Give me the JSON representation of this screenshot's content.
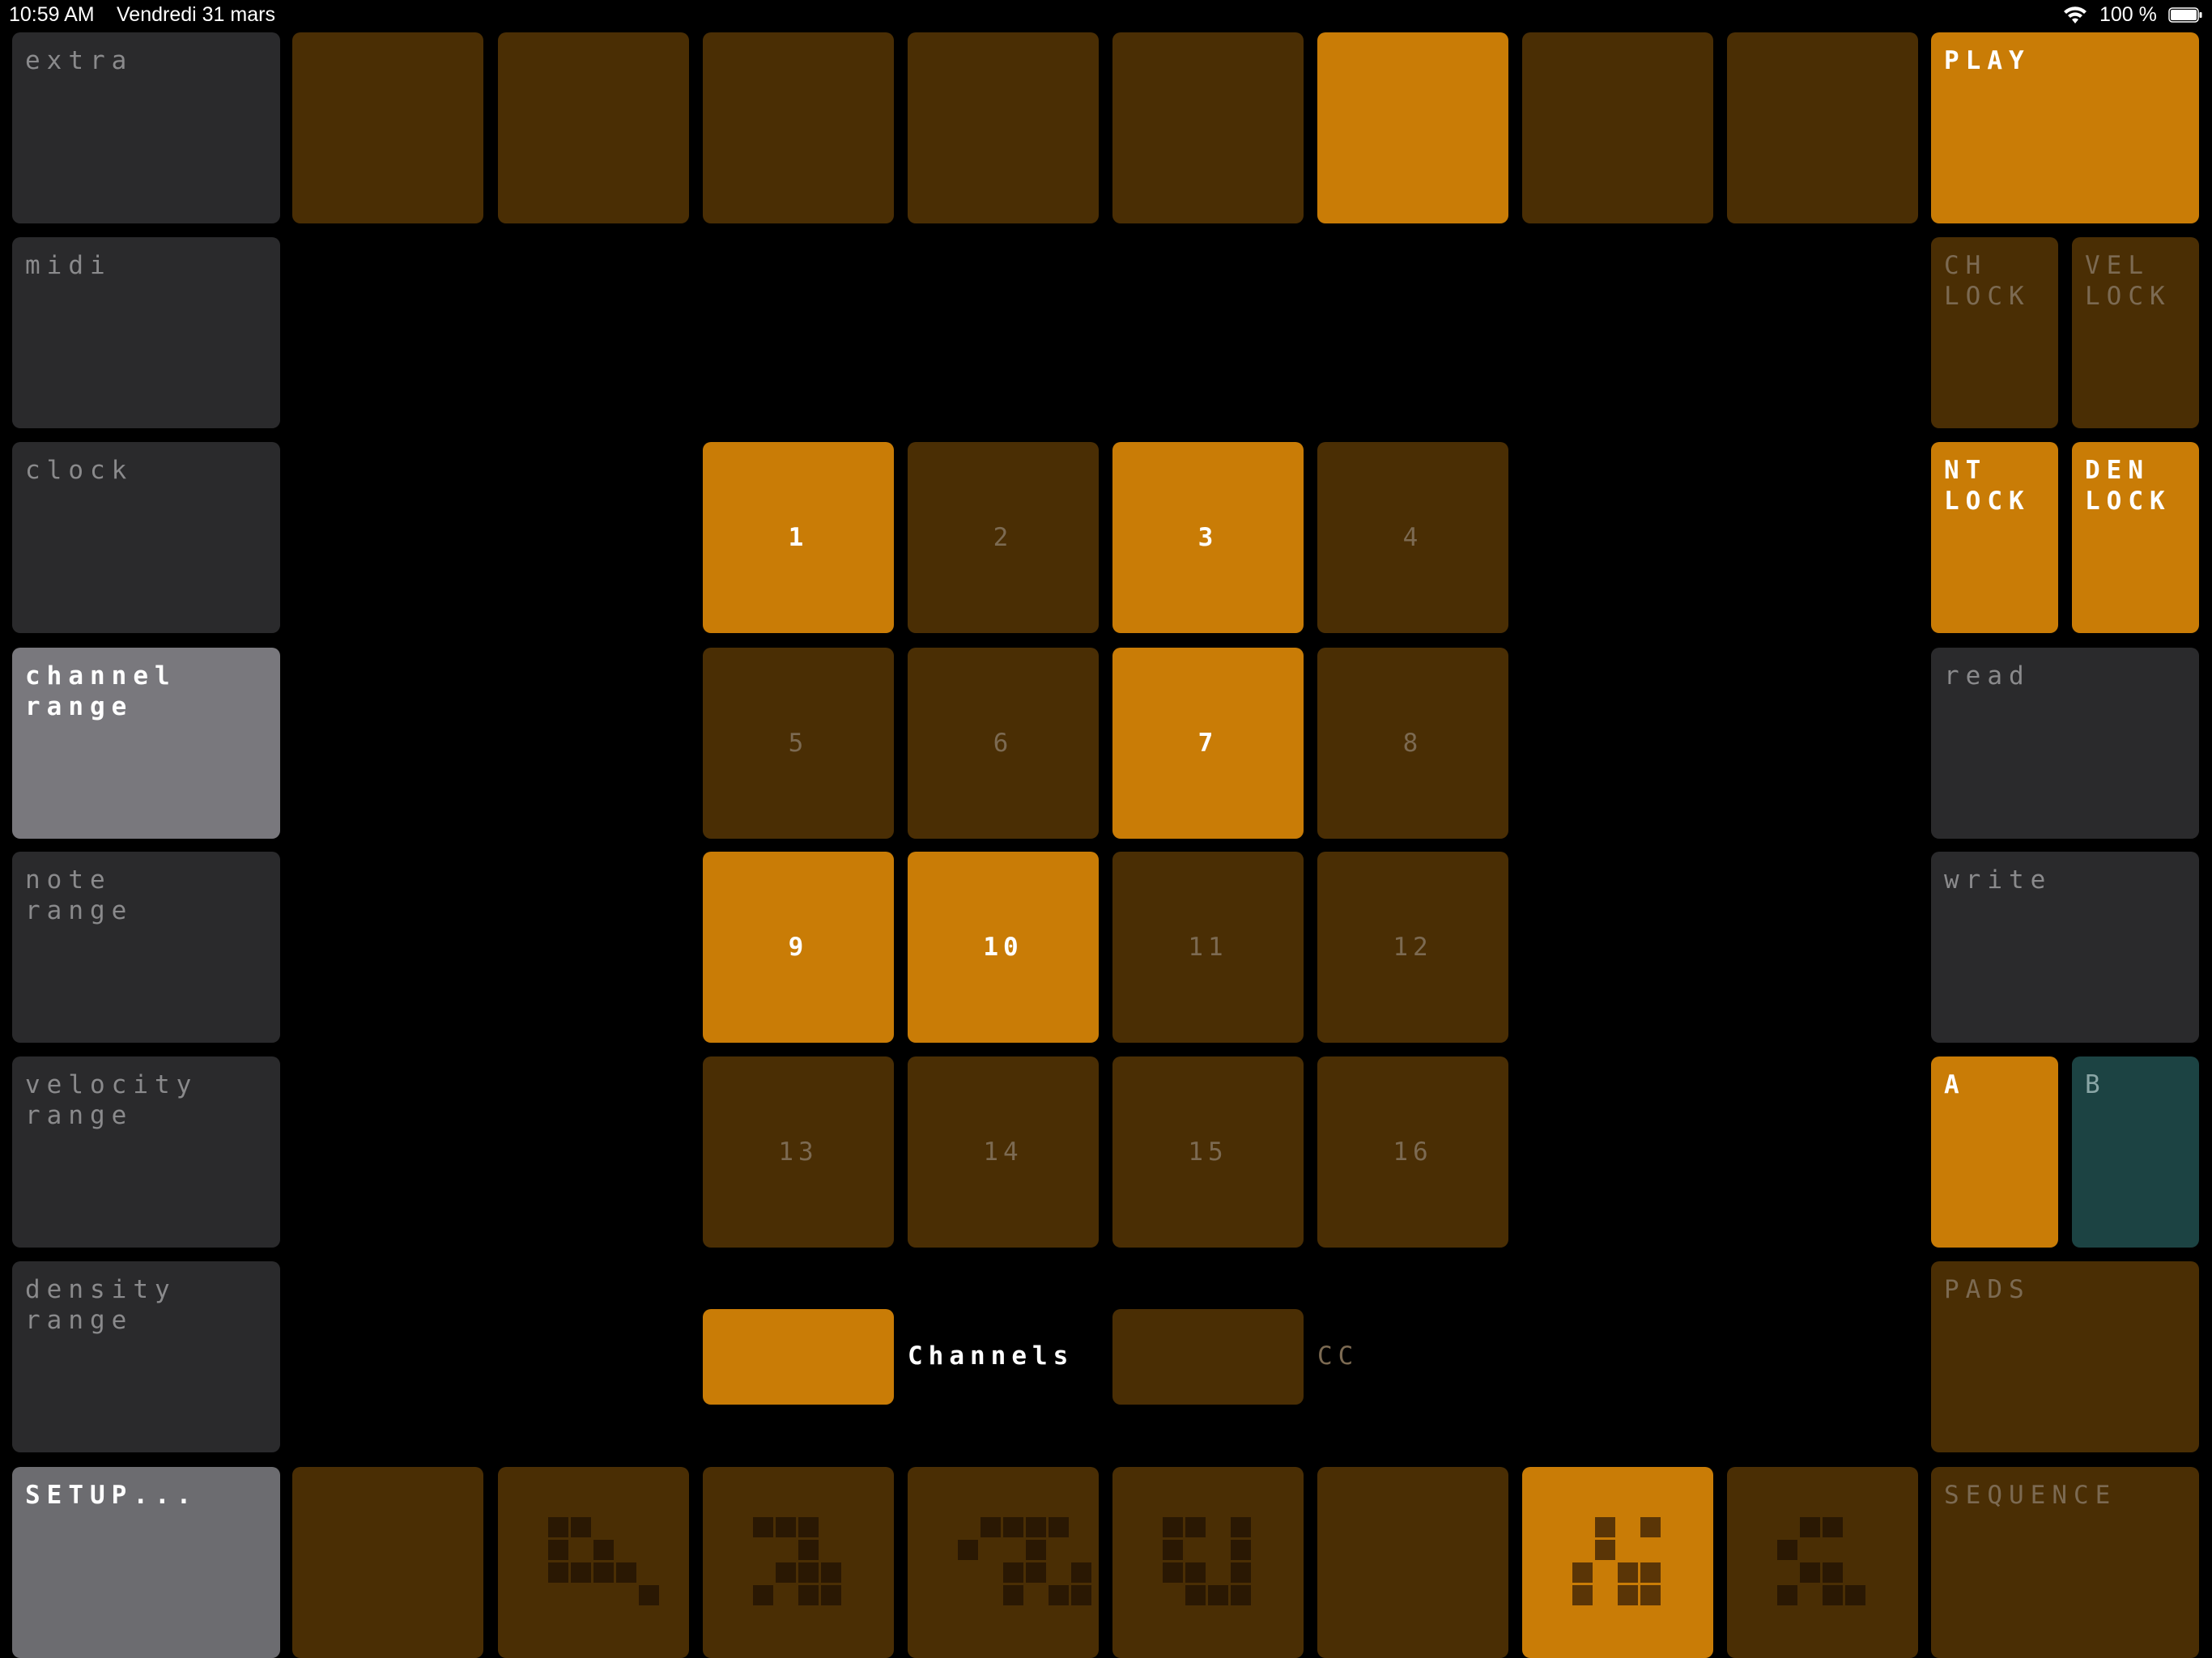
{
  "status_bar": {
    "time": "10:59 AM",
    "date": "Vendredi 31 mars",
    "battery": "100 %"
  },
  "colors": {
    "pad_off": "#4a2e04",
    "pad_on": "#c97c06",
    "gray": "#2a2a2c",
    "gray_on": "#79787d",
    "teal": "#1c4343"
  },
  "left_menu": [
    {
      "label": "extra",
      "active": false
    },
    {
      "label": "midi",
      "active": false
    },
    {
      "label": "clock",
      "active": false
    },
    {
      "label": "channel\nrange",
      "active": true
    },
    {
      "label": "note\nrange",
      "active": false
    },
    {
      "label": "velocity\nrange",
      "active": false
    },
    {
      "label": "density\nrange",
      "active": false
    }
  ],
  "setup_button": "SETUP...",
  "top_row": {
    "active_index": 5,
    "count": 8
  },
  "play_button": "PLAY",
  "locks": [
    {
      "label": "CH\nLOCK",
      "active": false
    },
    {
      "label": "VEL\nLOCK",
      "active": false
    },
    {
      "label": "NT\nLOCK",
      "active": true
    },
    {
      "label": "DEN\nLOCK",
      "active": true
    }
  ],
  "read_button": "read",
  "write_button": "write",
  "a_button": "A",
  "b_button": "B",
  "pads_button": "PADS",
  "sequence_button": "SEQUENCE",
  "channels": [
    {
      "label": "1",
      "active": true
    },
    {
      "label": "2",
      "active": false
    },
    {
      "label": "3",
      "active": true
    },
    {
      "label": "4",
      "active": false
    },
    {
      "label": "5",
      "active": false
    },
    {
      "label": "6",
      "active": false
    },
    {
      "label": "7",
      "active": true
    },
    {
      "label": "8",
      "active": false
    },
    {
      "label": "9",
      "active": true
    },
    {
      "label": "10",
      "active": true
    },
    {
      "label": "11",
      "active": false
    },
    {
      "label": "12",
      "active": false
    },
    {
      "label": "13",
      "active": false
    },
    {
      "label": "14",
      "active": false
    },
    {
      "label": "15",
      "active": false
    },
    {
      "label": "16",
      "active": false
    }
  ],
  "mode_toggle": {
    "channels_label": "Channels",
    "channels_active": true,
    "cc_label": "CC",
    "cc_active": false
  },
  "bottom_row": {
    "active_index": 6,
    "count": 8,
    "glyph_icons": [
      "",
      "pattern-glyph-icon",
      "pattern-glyph-icon",
      "pattern-glyph-icon",
      "pattern-glyph-icon",
      "",
      "pattern-glyph-icon",
      "pattern-glyph-icon"
    ]
  }
}
